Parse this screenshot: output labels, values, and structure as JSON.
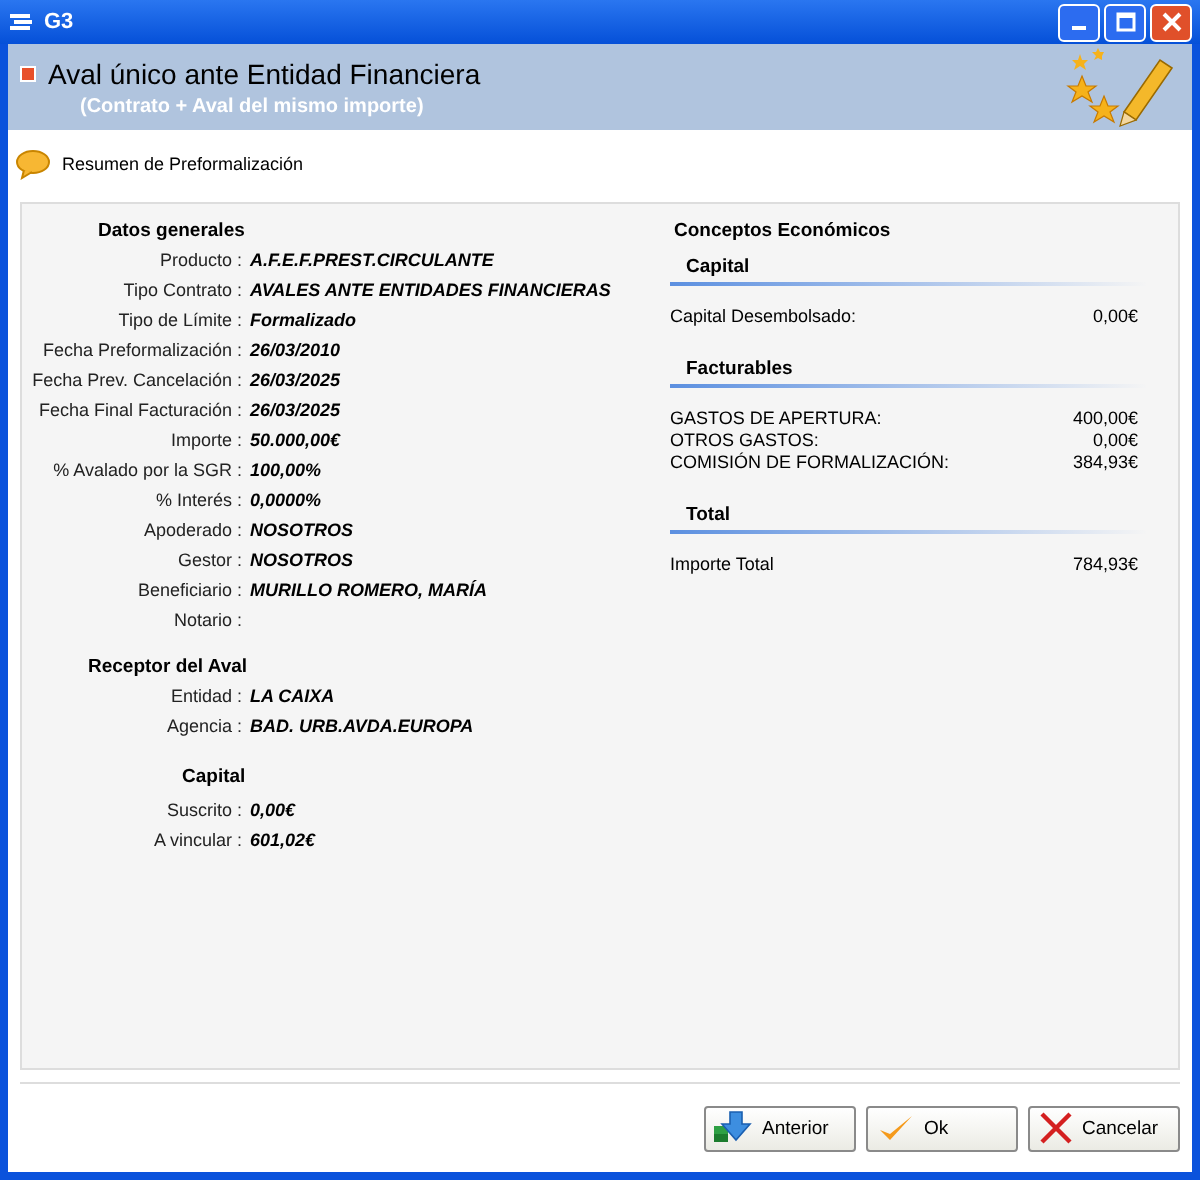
{
  "window": {
    "title": "G3"
  },
  "header": {
    "title": "Aval único ante Entidad Financiera",
    "subtitle": "(Contrato + Aval del mismo importe)"
  },
  "summary_label": "Resumen de Preformalización",
  "general": {
    "heading": "Datos generales",
    "fields": [
      {
        "label": "Producto :",
        "value": "A.F.E.F.PREST.CIRCULANTE"
      },
      {
        "label": "Tipo Contrato :",
        "value": "AVALES ANTE ENTIDADES FINANCIERAS"
      },
      {
        "label": "Tipo de Límite :",
        "value": "Formalizado"
      },
      {
        "label": "Fecha Preformalización :",
        "value": "26/03/2010"
      },
      {
        "label": "Fecha Prev. Cancelación :",
        "value": "26/03/2025"
      },
      {
        "label": "Fecha Final Facturación :",
        "value": "26/03/2025"
      },
      {
        "label": "Importe :",
        "value": "50.000,00€"
      },
      {
        "label": "% Avalado por la SGR :",
        "value": "100,00%"
      },
      {
        "label": "% Interés :",
        "value": "0,0000%"
      },
      {
        "label": "Apoderado :",
        "value": "NOSOTROS"
      },
      {
        "label": "Gestor :",
        "value": "NOSOTROS"
      },
      {
        "label": "Beneficiario :",
        "value": "MURILLO ROMERO, MARÍA"
      },
      {
        "label": "Notario :"
      }
    ]
  },
  "receptor": {
    "heading": "Receptor del Aval",
    "fields": [
      {
        "label": "Entidad :",
        "value": "LA CAIXA"
      },
      {
        "label": "Agencia :",
        "value": "BAD. URB.AVDA.EUROPA"
      }
    ]
  },
  "capital": {
    "heading": "Capital",
    "fields": [
      {
        "label": "Suscrito :",
        "value": "0,00€"
      },
      {
        "label": "A vincular :",
        "value": "601,02€"
      }
    ]
  },
  "economic": {
    "heading": "Conceptos Económicos",
    "sections": [
      {
        "heading": "Capital",
        "rows": [
          {
            "label": "Capital Desembolsado:",
            "value": "0,00€"
          }
        ]
      },
      {
        "heading": "Facturables",
        "rows": [
          {
            "label": "GASTOS DE APERTURA:",
            "value": "400,00€"
          },
          {
            "label": "OTROS GASTOS:",
            "value": "0,00€"
          },
          {
            "label": "COMISIÓN DE FORMALIZACIÓN:",
            "value": "384,93€"
          }
        ]
      },
      {
        "heading": "Total",
        "rows": [
          {
            "label": "Importe Total",
            "value": "784,93€"
          }
        ]
      }
    ]
  },
  "buttons": [
    {
      "label": "Anterior",
      "kind": "back"
    },
    {
      "label": "Ok",
      "kind": "ok"
    },
    {
      "label": "Cancelar",
      "kind": "cancel"
    }
  ]
}
